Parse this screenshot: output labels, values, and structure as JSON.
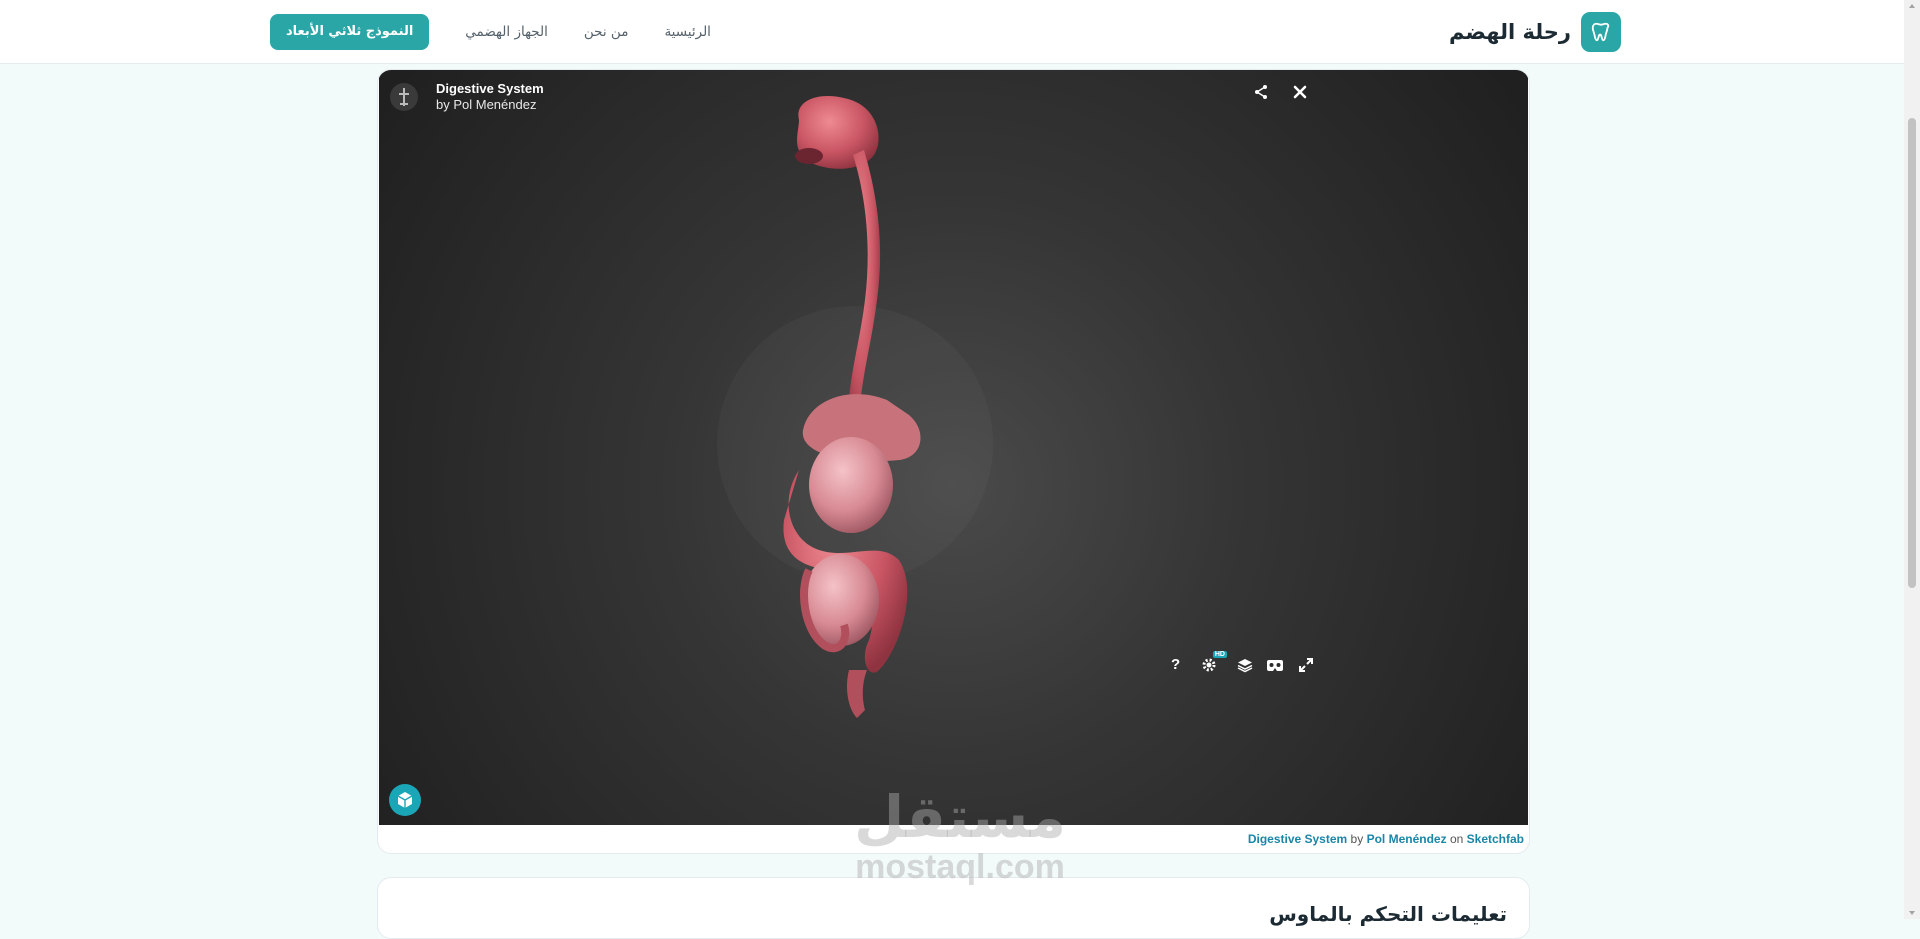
{
  "header": {
    "brand_name": "رحلة الهضم",
    "brand_icon": "tooth-icon",
    "accent_color": "#2aa6a7",
    "nav": [
      {
        "label": "الرئيسية"
      },
      {
        "label": "من نحن"
      },
      {
        "label": "الجهاز الهضمي"
      },
      {
        "label": "النموذج ثلاثي الأبعاد",
        "active": true
      }
    ]
  },
  "viewer": {
    "model_title": "Digestive System",
    "model_author": "by Pol Menéndez",
    "top_icons": [
      "share-icon",
      "close-icon"
    ],
    "bottom_icons": [
      "help-icon",
      "settings-icon",
      "layers-icon",
      "vr-icon",
      "fullscreen-icon"
    ],
    "help_label": "?",
    "hd_badge": "HD",
    "brand_logo": "sketchfab-logo"
  },
  "credits": {
    "model": "Digestive System",
    "by": "by",
    "author": "Pol Menéndez",
    "on": "on",
    "site": "Sketchfab"
  },
  "watermark": {
    "arabic": "مستقل",
    "latin": "mostaql.com"
  },
  "instructions": {
    "title": "تعليمات التحكم بالماوس"
  }
}
